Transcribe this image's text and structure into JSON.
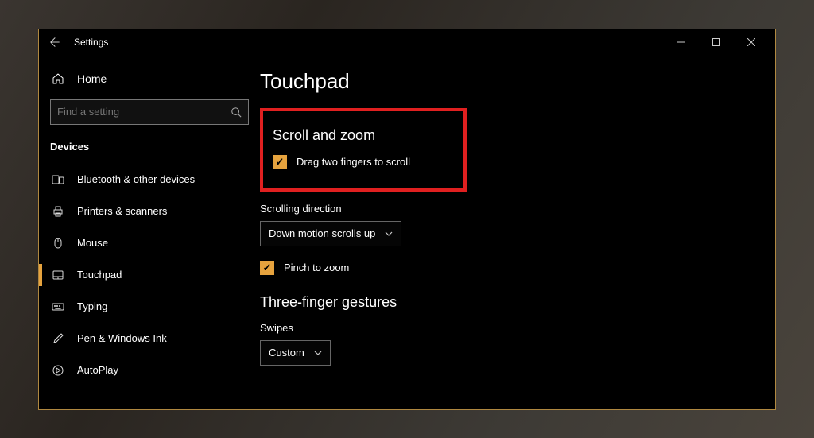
{
  "titlebar": {
    "title": "Settings"
  },
  "sidebar": {
    "home_label": "Home",
    "search_placeholder": "Find a setting",
    "group_label": "Devices",
    "items": [
      {
        "label": "Bluetooth & other devices"
      },
      {
        "label": "Printers & scanners"
      },
      {
        "label": "Mouse"
      },
      {
        "label": "Touchpad"
      },
      {
        "label": "Typing"
      },
      {
        "label": "Pen & Windows Ink"
      },
      {
        "label": "AutoPlay"
      }
    ]
  },
  "main": {
    "page_title": "Touchpad",
    "scroll_zoom_header": "Scroll and zoom",
    "drag_scroll_label": "Drag two fingers to scroll",
    "scrolling_direction_label": "Scrolling direction",
    "scrolling_direction_value": "Down motion scrolls up",
    "pinch_zoom_label": "Pinch to zoom",
    "three_finger_header": "Three-finger gestures",
    "swipes_label": "Swipes",
    "swipes_value": "Custom"
  }
}
